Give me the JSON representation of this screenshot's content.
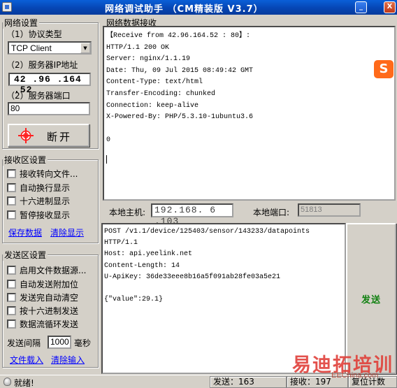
{
  "window": {
    "title": "网络调试助手 （CM精装版 V3.7）",
    "minimize_glyph": "_",
    "close_glyph": "X"
  },
  "net_settings": {
    "group_title": "网络设置",
    "protocol_label": "（1）协议类型",
    "protocol_value": "TCP Client",
    "ip_label": "（2）服务器IP地址",
    "ip_value": "42 .96 .164 .52",
    "port_label": "（2）服务器端口",
    "port_value": "80",
    "disconnect_label": "断开"
  },
  "recv_settings": {
    "group_title": "接收区设置",
    "options": [
      "接收转向文件...",
      "自动换行显示",
      "十六进制显示",
      "暂停接收显示"
    ],
    "save_link": "保存数据",
    "clear_link": "清除显示"
  },
  "send_settings": {
    "group_title": "发送区设置",
    "options": [
      "启用文件数据源...",
      "自动发送附加位",
      "发送完自动清空",
      "按十六进制发送",
      "数据流循环发送"
    ],
    "interval_label": "发送间隔",
    "interval_value": "1000",
    "interval_unit": "毫秒",
    "load_file_link": "文件载入",
    "clear_input_link": "清除输入"
  },
  "receive_area": {
    "group_title": "网络数据接收",
    "text": "【Receive from 42.96.164.52 : 80】:\nHTTP/1.1 200 OK\nServer: nginx/1.1.19\nDate: Thu, 09 Jul 2015 08:49:42 GMT\nContent-Type: text/html\nTransfer-Encoding: chunked\nConnection: keep-alive\nX-Powered-By: PHP/5.3.10-1ubuntu3.6\n\n0",
    "ime_icon_glyph": "S"
  },
  "local": {
    "host_label": "本地主机:",
    "host_value": "192.168. 6 .103",
    "port_label": "本地端口:",
    "port_value": "51813"
  },
  "send_area": {
    "text": "POST /v1.1/device/125403/sensor/143233/datapoints\nHTTP/1.1\nHost: api.yeelink.net\nContent-Length: 14\nU-ApiKey: 36de33eee8b16a5f091ab28fe03a5e21\n\n{\"value\":29.1}",
    "send_label": "发送"
  },
  "status_bar": {
    "ready": "就绪!",
    "sent": "发送：163",
    "received": "接收：197",
    "reset": "复位计数"
  },
  "watermark": {
    "cn": "易迪拓培训",
    "en": "EEChina.com"
  }
}
